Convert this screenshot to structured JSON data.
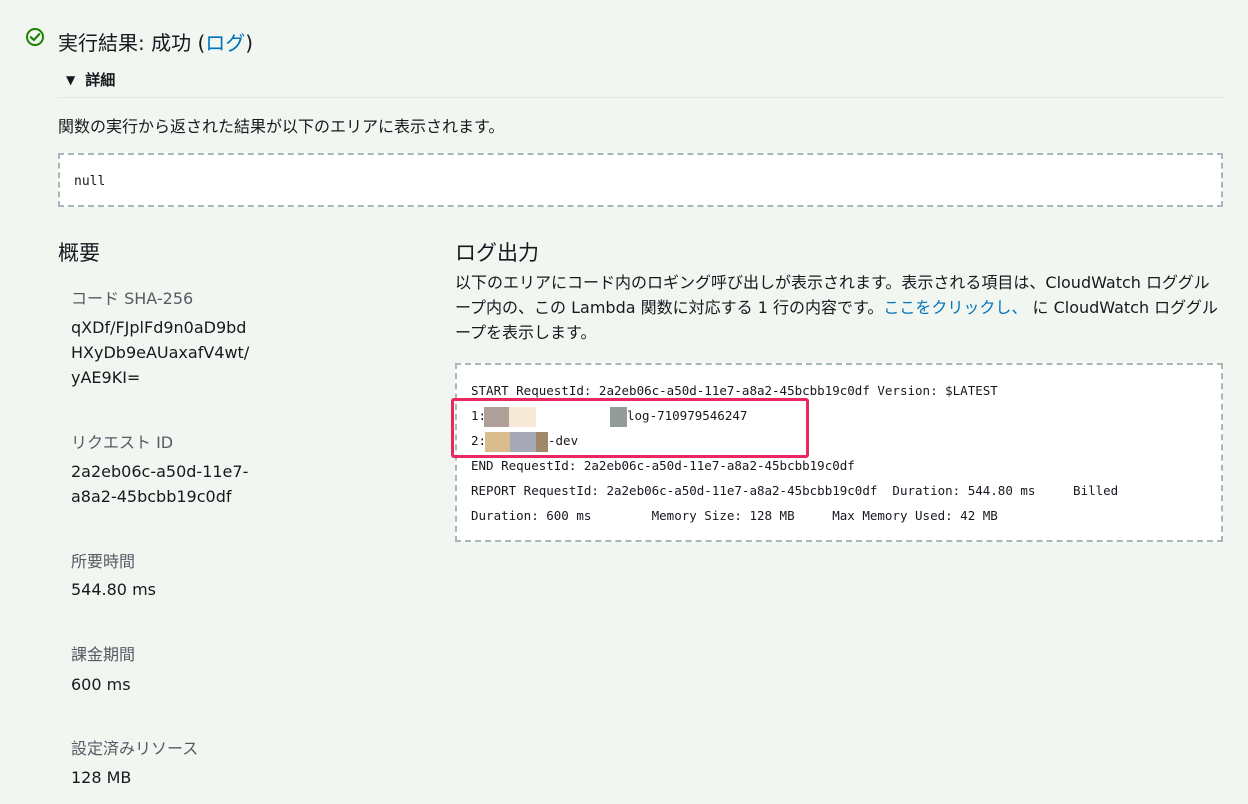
{
  "header": {
    "status_icon": "check-circle-icon",
    "status_color": "#1d8102",
    "title_prefix": "実行結果: 成功 (",
    "log_link": "ログ",
    "title_suffix": ")"
  },
  "details": {
    "toggle_icon": "caret-down-icon",
    "label": "詳細",
    "description": "関数の実行から返された結果が以下のエリアに表示されます。",
    "result": "null"
  },
  "summary": {
    "title": "概要",
    "items": [
      {
        "label": "コード SHA-256",
        "value_lines": [
          "qXDf/FJplFd9n0aD9bd",
          "HXyDb9eAUaxafV4wt/",
          "yAE9KI="
        ]
      },
      {
        "label": "リクエスト ID",
        "value_lines": [
          "2a2eb06c-a50d-11e7-",
          "a8a2-45bcbb19c0df"
        ]
      },
      {
        "label": "所要時間",
        "value_lines": [
          "544.80 ms"
        ]
      },
      {
        "label": "課金期間",
        "value_lines": [
          "600 ms"
        ]
      },
      {
        "label": "設定済みリソース",
        "value_lines": [
          "128 MB"
        ]
      }
    ]
  },
  "log": {
    "title": "ログ出力",
    "description_part1": "以下のエリアにコード内のロギング呼び出しが表示されます。表示される項目は、CloudWatch ロググループ内の、この Lambda 関数に対応する 1 行の内容です。",
    "description_link": "ここをクリックし、",
    "description_part2": " に CloudWatch ロググループを表示します。",
    "lines": {
      "start": "START RequestId: 2a2eb06c-a50d-11e7-a8a2-45bcbb19c0df Version: $LATEST",
      "line1_prefix": "1:",
      "line1_suffix": "log-710979546247",
      "line2_prefix": "2:",
      "line2_suffix": "-dev",
      "end": "END RequestId: 2a2eb06c-a50d-11e7-a8a2-45bcbb19c0df",
      "report1": "REPORT RequestId: 2a2eb06c-a50d-11e7-a8a2-45bcbb19c0df  Duration: 544.80 ms     Billed",
      "report2": "Duration: 600 ms        Memory Size: 128 MB     Max Memory Used: 42 MB"
    },
    "highlight_color": "#e8285f"
  }
}
